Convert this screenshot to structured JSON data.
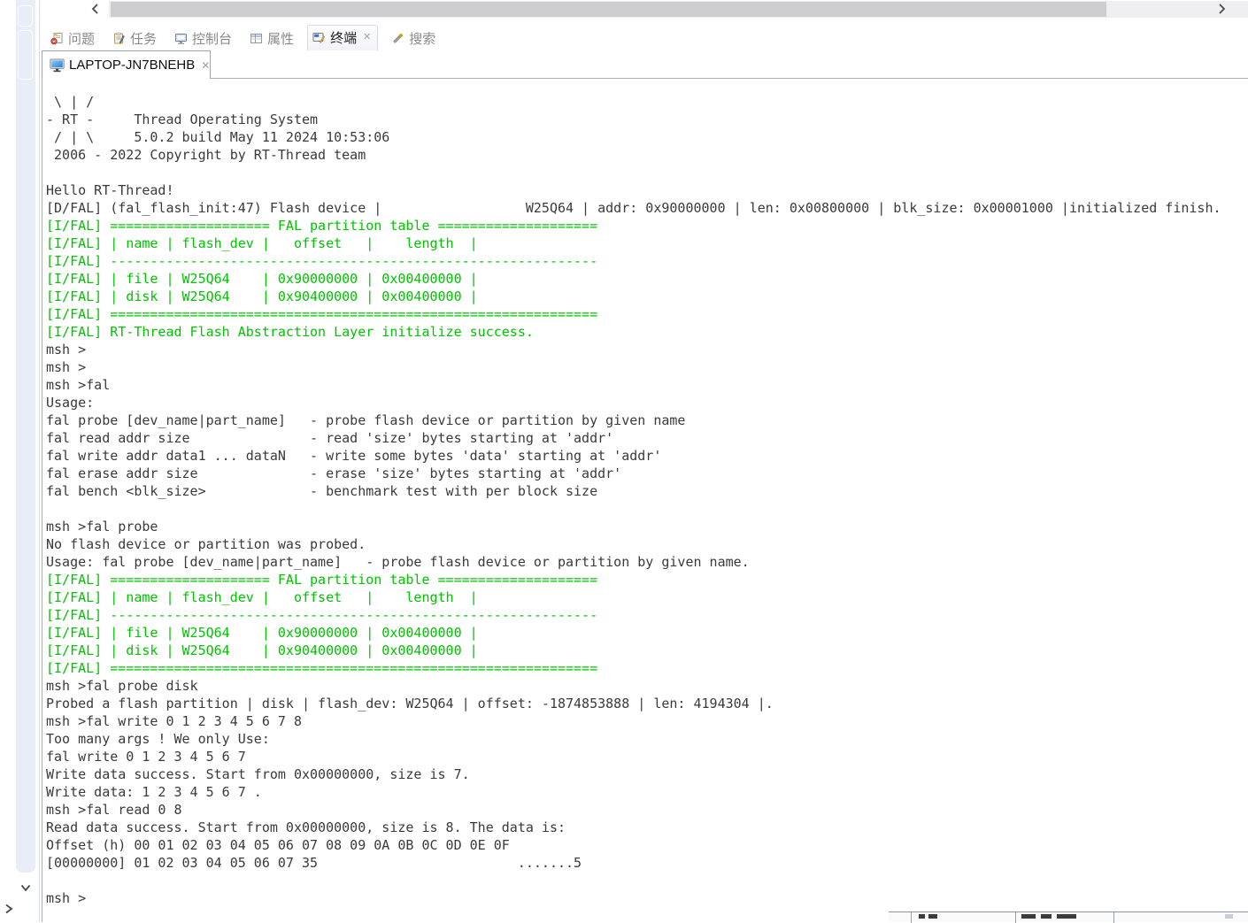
{
  "colors": {
    "log_green": "#00c400",
    "log_dark": "#3a3a3a",
    "trim_strip": "#e9edf8",
    "tab_inactive_text": "#8a8a8a"
  },
  "scrollbar": {
    "left_arrow": "chevron-left",
    "right_arrow": "chevron-right"
  },
  "trim": {
    "bottom_down_arrow": "chevron-down",
    "bottom_right_arrow": "chevron-right"
  },
  "view_tabs": {
    "active": "终端",
    "items": [
      {
        "label": "问题",
        "icon": "problems-icon"
      },
      {
        "label": "任务",
        "icon": "tasks-icon"
      },
      {
        "label": "控制台",
        "icon": "console-icon"
      },
      {
        "label": "属性",
        "icon": "properties-icon"
      },
      {
        "label": "终端",
        "icon": "terminal-icon",
        "close": "✕"
      },
      {
        "label": "搜索",
        "icon": "search-icon"
      }
    ]
  },
  "terminal_tab": {
    "label": "LAPTOP-JN7BNEHB",
    "icon": "monitor-icon",
    "close": "✕"
  },
  "terminal": {
    "lines": [
      {
        "t": " \\ | /",
        "c": "d"
      },
      {
        "t": "- RT -     Thread Operating System",
        "c": "d"
      },
      {
        "t": " / | \\     5.0.2 build May 11 2024 10:53:06",
        "c": "d"
      },
      {
        "t": " 2006 - 2022 Copyright by RT-Thread team",
        "c": "d"
      },
      {
        "t": "",
        "c": "d"
      },
      {
        "t": "Hello RT-Thread!",
        "c": "d"
      },
      {
        "t": "[D/FAL] (fal_flash_init:47) Flash device |                  W25Q64 | addr: 0x90000000 | len: 0x00800000 | blk_size: 0x00001000 |initialized finish.",
        "c": "d"
      },
      {
        "t": "[I/FAL] ==================== FAL partition table ====================",
        "c": "g"
      },
      {
        "t": "[I/FAL] | name | flash_dev |   offset   |    length  |",
        "c": "g"
      },
      {
        "t": "[I/FAL] -------------------------------------------------------------",
        "c": "g"
      },
      {
        "t": "[I/FAL] | file | W25Q64    | 0x90000000 | 0x00400000 |",
        "c": "g"
      },
      {
        "t": "[I/FAL] | disk | W25Q64    | 0x90400000 | 0x00400000 |",
        "c": "g"
      },
      {
        "t": "[I/FAL] =============================================================",
        "c": "g"
      },
      {
        "t": "[I/FAL] RT-Thread Flash Abstraction Layer initialize success.",
        "c": "g"
      },
      {
        "t": "msh >",
        "c": "d"
      },
      {
        "t": "msh >",
        "c": "d"
      },
      {
        "t": "msh >fal",
        "c": "d"
      },
      {
        "t": "Usage:",
        "c": "d"
      },
      {
        "t": "fal probe [dev_name|part_name]   - probe flash device or partition by given name",
        "c": "d"
      },
      {
        "t": "fal read addr size               - read 'size' bytes starting at 'addr'",
        "c": "d"
      },
      {
        "t": "fal write addr data1 ... dataN   - write some bytes 'data' starting at 'addr'",
        "c": "d"
      },
      {
        "t": "fal erase addr size              - erase 'size' bytes starting at 'addr'",
        "c": "d"
      },
      {
        "t": "fal bench <blk_size>             - benchmark test with per block size",
        "c": "d"
      },
      {
        "t": "",
        "c": "d"
      },
      {
        "t": "msh >fal probe",
        "c": "d"
      },
      {
        "t": "No flash device or partition was probed.",
        "c": "d"
      },
      {
        "t": "Usage: fal probe [dev_name|part_name]   - probe flash device or partition by given name.",
        "c": "d"
      },
      {
        "t": "[I/FAL] ==================== FAL partition table ====================",
        "c": "g"
      },
      {
        "t": "[I/FAL] | name | flash_dev |   offset   |    length  |",
        "c": "g"
      },
      {
        "t": "[I/FAL] -------------------------------------------------------------",
        "c": "g"
      },
      {
        "t": "[I/FAL] | file | W25Q64    | 0x90000000 | 0x00400000 |",
        "c": "g"
      },
      {
        "t": "[I/FAL] | disk | W25Q64    | 0x90400000 | 0x00400000 |",
        "c": "g"
      },
      {
        "t": "[I/FAL] =============================================================",
        "c": "g"
      },
      {
        "t": "msh >fal probe disk",
        "c": "d"
      },
      {
        "t": "Probed a flash partition | disk | flash_dev: W25Q64 | offset: -1874853888 | len: 4194304 |.",
        "c": "d"
      },
      {
        "t": "msh >fal write 0 1 2 3 4 5 6 7 8",
        "c": "d"
      },
      {
        "t": "Too many args ! We only Use:",
        "c": "d"
      },
      {
        "t": "fal write 0 1 2 3 4 5 6 7",
        "c": "d"
      },
      {
        "t": "Write data success. Start from 0x00000000, size is 7.",
        "c": "d"
      },
      {
        "t": "Write data: 1 2 3 4 5 6 7 .",
        "c": "d"
      },
      {
        "t": "msh >fal read 0 8",
        "c": "d"
      },
      {
        "t": "Read data success. Start from 0x00000000, size is 8. The data is:",
        "c": "d"
      },
      {
        "t": "Offset (h) 00 01 02 03 04 05 06 07 08 09 0A 0B 0C 0D 0E 0F",
        "c": "d"
      },
      {
        "t": "[00000000] 01 02 03 04 05 06 07 35                         .......5",
        "c": "d"
      },
      {
        "t": "",
        "c": "d"
      },
      {
        "t": "msh >",
        "c": "d"
      }
    ]
  }
}
